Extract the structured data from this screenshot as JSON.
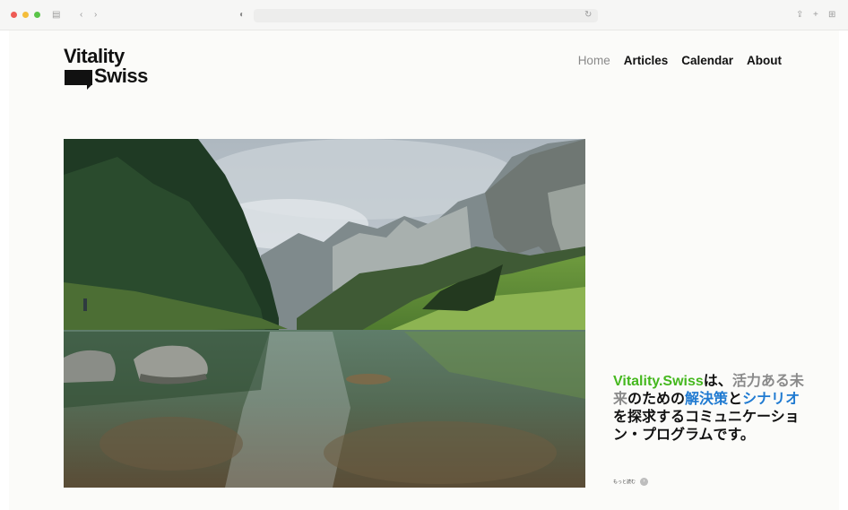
{
  "browser": {
    "forward_glyph": "›",
    "back_glyph": "‹",
    "sidebar_glyph": "▤",
    "reload_glyph": "↻",
    "share_glyph": "⇪",
    "new_tab_glyph": "+",
    "tabs_glyph": "⊞"
  },
  "site": {
    "logo_line1": "Vitality",
    "logo_line2": "Swiss"
  },
  "nav": {
    "items": [
      "Home",
      "Articles",
      "Calendar",
      "About"
    ],
    "active": "Home"
  },
  "hero": {
    "image": "mountain-lake-photo"
  },
  "tagline": {
    "brand": "Vitality.Swiss",
    "part1": "は、",
    "gray": "活力ある未来",
    "part2": "のための",
    "blue1": "解決策",
    "part3": "と",
    "blue2": "シナリオ",
    "part4": "を探求するコミュニケーション・プログラムです。"
  },
  "more": {
    "label": "もっと読む",
    "icon": "arrow-right-icon"
  },
  "colors": {
    "brand_green": "#45b81e",
    "accent_blue": "#1f7ad1",
    "muted_gray": "#8a8a8a"
  }
}
